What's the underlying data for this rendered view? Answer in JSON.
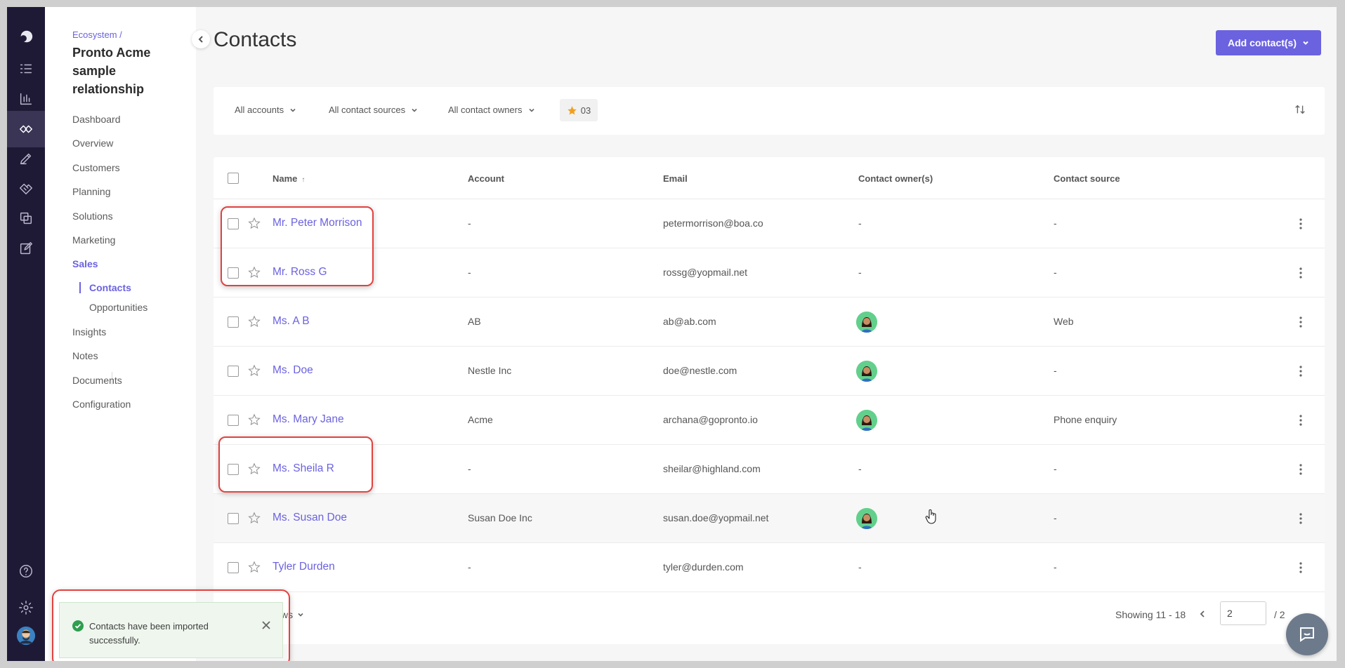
{
  "breadcrumb": "Ecosystem /",
  "workspace_title": "Pronto Acme sample relationship",
  "nav": {
    "items": [
      {
        "label": "Dashboard"
      },
      {
        "label": "Overview"
      },
      {
        "label": "Customers"
      },
      {
        "label": "Planning"
      },
      {
        "label": "Solutions"
      },
      {
        "label": "Marketing"
      },
      {
        "label": "Sales",
        "active": true
      },
      {
        "label": "Insights"
      },
      {
        "label": "Notes"
      },
      {
        "label": "Documents"
      },
      {
        "label": "Configuration"
      }
    ],
    "sales_sub": [
      {
        "label": "Contacts",
        "active": true
      },
      {
        "label": "Opportunities"
      }
    ]
  },
  "rail_icons": [
    "logo-icon",
    "tasks-icon",
    "analytics-icon",
    "ecosystem-icon",
    "pen-icon",
    "handshake-icon",
    "templates-icon",
    "edit-icon",
    "help-icon",
    "settings-icon",
    "user-avatar-icon"
  ],
  "page": {
    "title": "Contacts",
    "add_button": "Add contact(s)"
  },
  "filters": {
    "accounts": "All accounts",
    "sources": "All contact sources",
    "owners": "All contact owners",
    "favorites_count": "03"
  },
  "table": {
    "headers": {
      "name": "Name",
      "account": "Account",
      "email": "Email",
      "owner": "Contact owner(s)",
      "source": "Contact source"
    },
    "rows": [
      {
        "name": "Mr. Peter Morrison",
        "account": "-",
        "email": "petermorrison@boa.co",
        "owner": "-",
        "source": "-"
      },
      {
        "name": "Mr. Ross G",
        "account": "-",
        "email": "rossg@yopmail.net",
        "owner": "-",
        "source": "-"
      },
      {
        "name": "Ms. A B",
        "account": "AB",
        "email": "ab@ab.com",
        "owner": "avatar",
        "source": "Web"
      },
      {
        "name": "Ms. Doe",
        "account": "Nestle Inc",
        "email": "doe@nestle.com",
        "owner": "avatar",
        "source": "-"
      },
      {
        "name": "Ms. Mary Jane",
        "account": "Acme",
        "email": "archana@gopronto.io",
        "owner": "avatar",
        "source": "Phone enquiry"
      },
      {
        "name": "Ms. Sheila R",
        "account": "-",
        "email": "sheilar@highland.com",
        "owner": "-",
        "source": "-"
      },
      {
        "name": "Ms. Susan Doe",
        "account": "Susan Doe Inc",
        "email": "susan.doe@yopmail.net",
        "owner": "avatar",
        "source": "-"
      },
      {
        "name": "Tyler Durden",
        "account": "-",
        "email": "tyler@durden.com",
        "owner": "-",
        "source": "-"
      }
    ]
  },
  "footer": {
    "rows_label": "ws",
    "showing": "Showing 11 - 18",
    "page_value": "2",
    "page_total": "/ 2"
  },
  "toast": {
    "message": "Contacts have been imported successfully."
  },
  "colors": {
    "accent": "#6b62e0",
    "rail": "#1e1a36",
    "annotation": "#e2413e",
    "success": "#2e9e4f"
  }
}
